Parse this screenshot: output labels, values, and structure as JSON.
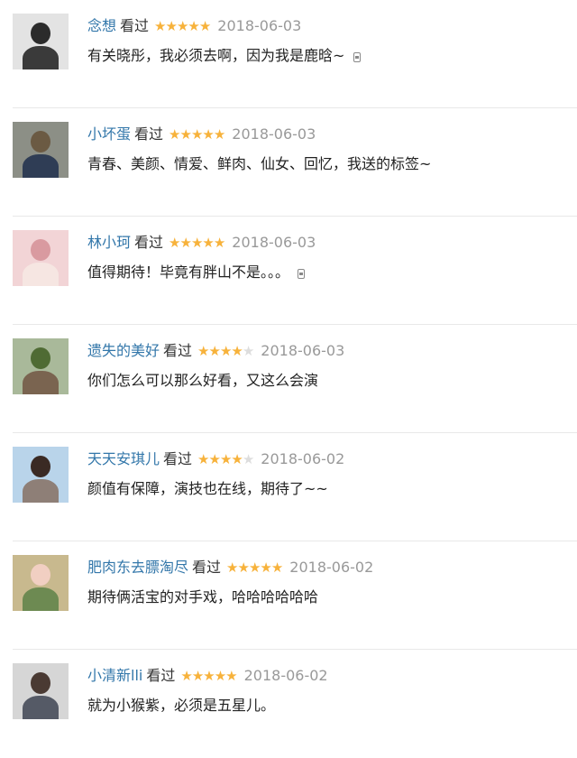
{
  "comments": [
    {
      "name": "念想",
      "status": "看过",
      "rating": 5,
      "date": "2018-06-03",
      "text": "有关晓彤，我必须去啊，因为我是鹿晗~",
      "expandable": true,
      "avatar": {
        "bg": "#e3e3e3",
        "head": "#2b2b2b",
        "body": "#3a3a3a"
      }
    },
    {
      "name": "小坏蛋",
      "status": "看过",
      "rating": 5,
      "date": "2018-06-03",
      "text": "青春、美颜、情爱、鲜肉、仙女、回忆，我送的标签~",
      "expandable": false,
      "avatar": {
        "bg": "#8c8f86",
        "head": "#6b5a43",
        "body": "#2f3d55"
      }
    },
    {
      "name": "林小珂",
      "status": "看过",
      "rating": 5,
      "date": "2018-06-03",
      "text": "值得期待！毕竟有胖山不是。。。",
      "expandable": true,
      "avatar": {
        "bg": "#f2d4d6",
        "head": "#d99aa0",
        "body": "#f6e6e2"
      }
    },
    {
      "name": "遗失的美好",
      "status": "看过",
      "rating": 4,
      "date": "2018-06-03",
      "text": "你们怎么可以那么好看，又这么会演",
      "expandable": false,
      "avatar": {
        "bg": "#a9b99a",
        "head": "#4f6b34",
        "body": "#7a6450"
      }
    },
    {
      "name": "天天安琪儿",
      "status": "看过",
      "rating": 4,
      "date": "2018-06-02",
      "text": "颜值有保障，演技也在线，期待了~~",
      "expandable": false,
      "avatar": {
        "bg": "#b9d4ea",
        "head": "#3a2a24",
        "body": "#8e7f77"
      }
    },
    {
      "name": "肥肉东去膘淘尽",
      "status": "看过",
      "rating": 5,
      "date": "2018-06-02",
      "text": "期待俩活宝的对手戏，哈哈哈哈哈哈",
      "expandable": false,
      "avatar": {
        "bg": "#c8b98e",
        "head": "#f1cfc2",
        "body": "#6d8a52"
      }
    },
    {
      "name": "小清新lli",
      "status": "看过",
      "rating": 5,
      "date": "2018-06-02",
      "text": "就为小猴紫，必须是五星儿。",
      "expandable": false,
      "avatar": {
        "bg": "#d6d6d6",
        "head": "#4a3a33",
        "body": "#555a66"
      }
    }
  ],
  "star_colors": {
    "on": "#f7b23b",
    "off": "#dddddd"
  }
}
